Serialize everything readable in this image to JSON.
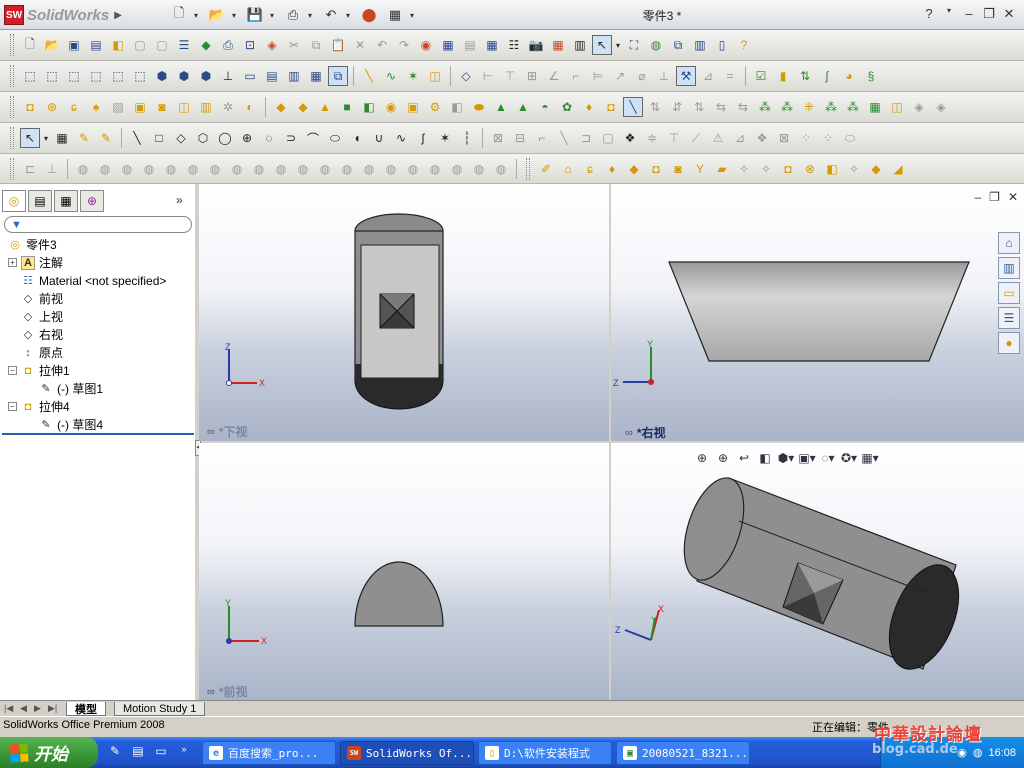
{
  "app": {
    "logo_text": "SolidWorks",
    "logo_badge": "SW",
    "doc_title": "零件3 *",
    "help": "?",
    "min": "–",
    "restore": "❐",
    "close": "✕"
  },
  "quick_access": [
    "□",
    "▶",
    "▣",
    "⎙",
    "↶",
    "◉",
    "▦"
  ],
  "feature_manager": {
    "tabs": [
      "feature-tab",
      "property-tab",
      "config-tab",
      "dimxpert-tab"
    ],
    "expand_glyph": "»",
    "filter_glyph": "▼",
    "tree": [
      {
        "label": "零件3",
        "indent": 0,
        "icon": "part-icon",
        "expand": ""
      },
      {
        "label": "注解",
        "indent": 1,
        "icon": "annotation-icon",
        "expand": "+"
      },
      {
        "label": "Material <not specified>",
        "indent": 1,
        "icon": "material-icon",
        "expand": ""
      },
      {
        "label": "前视",
        "indent": 1,
        "icon": "plane-icon",
        "expand": ""
      },
      {
        "label": "上视",
        "indent": 1,
        "icon": "plane-icon",
        "expand": ""
      },
      {
        "label": "右视",
        "indent": 1,
        "icon": "plane-icon",
        "expand": ""
      },
      {
        "label": "原点",
        "indent": 1,
        "icon": "origin-icon",
        "expand": ""
      },
      {
        "label": "拉伸1",
        "indent": 1,
        "icon": "extrude-icon",
        "expand": "−"
      },
      {
        "label": "(-) 草图1",
        "indent": 2,
        "icon": "sketch-icon",
        "expand": ""
      },
      {
        "label": "拉伸4",
        "indent": 1,
        "icon": "extrude-icon",
        "expand": "−"
      },
      {
        "label": "(-) 草图4",
        "indent": 2,
        "icon": "sketch-icon",
        "expand": ""
      }
    ]
  },
  "viewports": {
    "top_left": {
      "label": "*下视"
    },
    "top_right": {
      "label": "*右视"
    },
    "bottom_left": {
      "label": "*前视"
    },
    "bottom_right": {
      "label": ""
    }
  },
  "bottom_tabs": {
    "model": "模型",
    "motion": "Motion Study 1"
  },
  "status": {
    "left": "SolidWorks Office Premium 2008",
    "right": "正在编辑：零件"
  },
  "taskbar": {
    "start": "开始",
    "tasks": [
      {
        "label": "百度搜索_pro...",
        "icon": "ie-icon"
      },
      {
        "label": "SolidWorks Of...",
        "icon": "solidworks-icon"
      },
      {
        "label": "D:\\软件安装程式",
        "icon": "folder-icon"
      },
      {
        "label": "20080521_8321...",
        "icon": "image-icon"
      }
    ],
    "clock": "16:08"
  },
  "watermark": {
    "line1": "中華設計論壇",
    "line2": "blog.cad.de"
  },
  "colors": {
    "taskbar": "#245edb",
    "start": "#3c9a38",
    "model_fill": "#8c8c8c",
    "model_dark": "#2a2a2a",
    "label": "#1a2a66"
  }
}
